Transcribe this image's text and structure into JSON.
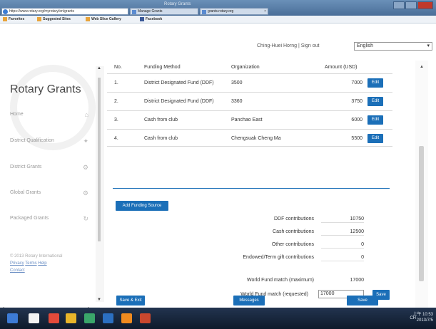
{
  "browser": {
    "url": "https://www.rotary.org/myrotary/en/grants",
    "window_title": "Rotary Grants",
    "tabs": [
      {
        "label": "Manage Grants",
        "icon": "rotary-tab-icon"
      },
      {
        "label": "grants.rotary.org",
        "icon": "rotary-tab-icon"
      }
    ],
    "favorites": [
      {
        "label": "Favorites"
      },
      {
        "label": "Suggested Sites"
      },
      {
        "label": "Web Slice Gallery"
      },
      {
        "label": "Facebook"
      }
    ]
  },
  "header": {
    "user_link": "Ching-Huei Horng | Sign out",
    "language": "English"
  },
  "sidebar": {
    "brand": "Rotary Grants",
    "items": [
      {
        "label": "Home",
        "icon": "home-icon"
      },
      {
        "label": "District Qualification",
        "icon": "ribbon-icon"
      },
      {
        "label": "District Grants",
        "icon": "gear-icon"
      },
      {
        "label": "Global Grants",
        "icon": "gear-icon"
      },
      {
        "label": "Packaged Grants",
        "icon": "refresh-icon"
      }
    ],
    "footer": {
      "copyright": "© 2013 Rotary International",
      "privacy": "Privacy",
      "terms": "Terms",
      "help": "Help",
      "contact": "Contact"
    }
  },
  "funding": {
    "columns": [
      "No.",
      "Funding Method",
      "Organization",
      "Amount (USD)"
    ],
    "rows": [
      {
        "no": "1.",
        "method": "District Designated Fund (DDF)",
        "org": "3500",
        "amount": "7000",
        "action": "Edit"
      },
      {
        "no": "2.",
        "method": "District Designated Fund (DDF)",
        "org": "3360",
        "amount": "3750",
        "action": "Edit"
      },
      {
        "no": "3.",
        "method": "Cash from club",
        "org": "Panchao East",
        "amount": "6000",
        "action": "Edit"
      },
      {
        "no": "4.",
        "method": "Cash from club",
        "org": "Chengsuak Cheng Ma",
        "amount": "5500",
        "action": "Edit"
      }
    ],
    "add_label": "Add Funding Source"
  },
  "summary": {
    "ddf_label": "DDF contributions",
    "ddf_value": "10750",
    "cash_label": "Cash contributions",
    "cash_value": "12500",
    "other_label": "Other contributions",
    "other_value": "0",
    "endowed_label": "Endowed/Term gift contributions",
    "endowed_value": "0",
    "wf_max_label": "World Fund match (maximum)",
    "wf_max_value": "17000",
    "wf_req_label": "World Fund match (requested)",
    "wf_req_value": "17000",
    "save_label": "Save"
  },
  "footer_actions": {
    "save_exit": "Save & Exit",
    "messages": "Messages",
    "save": "Save"
  },
  "taskbar": {
    "tray_text": "CH",
    "time": "上午 10:53",
    "date": "2013/7/5"
  },
  "colors": {
    "accent": "#1b6fb8",
    "sidebar_text": "#999999"
  }
}
